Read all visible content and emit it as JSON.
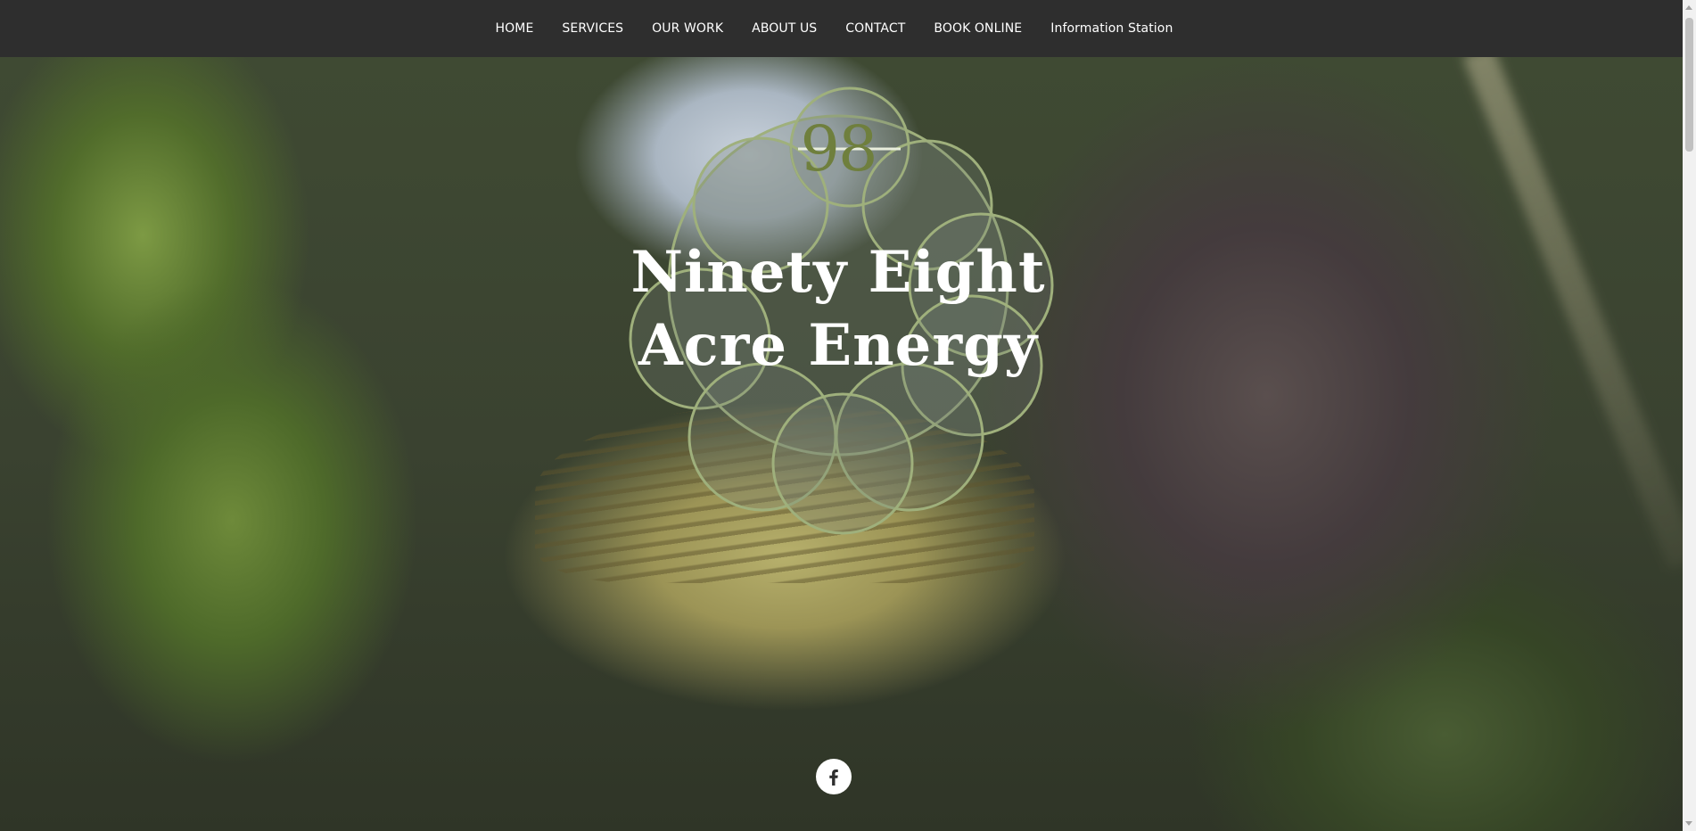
{
  "nav": {
    "items": [
      {
        "label": "HOME"
      },
      {
        "label": "SERVICES"
      },
      {
        "label": "OUR WORK"
      },
      {
        "label": "ABOUT US"
      },
      {
        "label": "CONTACT"
      },
      {
        "label": "BOOK ONLINE"
      },
      {
        "label": "Information Station"
      }
    ]
  },
  "logo": {
    "number": "98",
    "title_line1": "Ninety Eight",
    "title_line2": "Acre Energy"
  },
  "social": {
    "icon": "facebook-icon"
  },
  "colors": {
    "nav_bg": "#2e2e2e",
    "logo_accent": "#6f7f3d",
    "emblem_outline": "#9fb07c"
  }
}
